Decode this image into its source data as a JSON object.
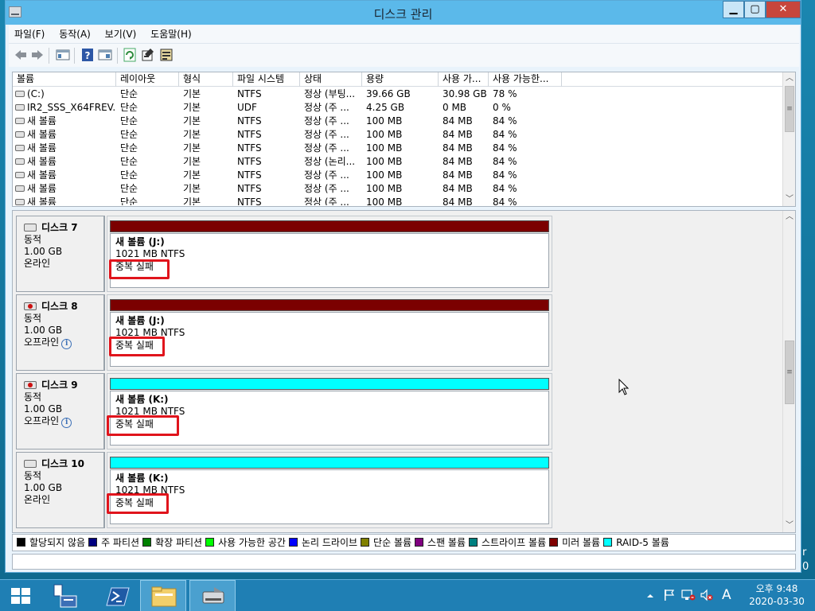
{
  "window": {
    "title": "디스크 관리",
    "min": "▁",
    "max": "▢",
    "close": "✕"
  },
  "menu": [
    "파일(F)",
    "동작(A)",
    "보기(V)",
    "도움말(H)"
  ],
  "volumes": {
    "columns": [
      "볼륨",
      "레이아웃",
      "형식",
      "파일 시스템",
      "상태",
      "용량",
      "사용 가...",
      "사용 가능한..."
    ],
    "rows": [
      [
        "(C:)",
        "단순",
        "기본",
        "NTFS",
        "정상 (부팅...",
        "39.66 GB",
        "30.98 GB",
        "78 %"
      ],
      [
        "IR2_SSS_X64FREV...",
        "단순",
        "기본",
        "UDF",
        "정상 (주 ...",
        "4.25 GB",
        "0 MB",
        "0 %"
      ],
      [
        "새 볼륨",
        "단순",
        "기본",
        "NTFS",
        "정상 (주 ...",
        "100 MB",
        "84 MB",
        "84 %"
      ],
      [
        "새 볼륨",
        "단순",
        "기본",
        "NTFS",
        "정상 (주 ...",
        "100 MB",
        "84 MB",
        "84 %"
      ],
      [
        "새 볼륨",
        "단순",
        "기본",
        "NTFS",
        "정상 (주 ...",
        "100 MB",
        "84 MB",
        "84 %"
      ],
      [
        "새 볼륨",
        "단순",
        "기본",
        "NTFS",
        "정상 (논리...",
        "100 MB",
        "84 MB",
        "84 %"
      ],
      [
        "새 볼륨",
        "단순",
        "기본",
        "NTFS",
        "정상 (주 ...",
        "100 MB",
        "84 MB",
        "84 %"
      ],
      [
        "새 볼륨",
        "단순",
        "기본",
        "NTFS",
        "정상 (주 ...",
        "100 MB",
        "84 MB",
        "84 %"
      ],
      [
        "새 볼륨",
        "단순",
        "기본",
        "NTFS",
        "정상 (주 ...",
        "100 MB",
        "84 MB",
        "84 %"
      ]
    ]
  },
  "disks": [
    {
      "name": "디스크 7",
      "type": "동적",
      "size": "1.00 GB",
      "status": "온라인",
      "info": false,
      "bar_color": "#7b0000",
      "vol_name": "새 볼륨  (J:)",
      "vol_size": "1021 MB NTFS",
      "vol_status": "중복 실패"
    },
    {
      "name": "디스크 8",
      "type": "동적",
      "size": "1.00 GB",
      "status": "오프라인",
      "info": true,
      "bar_color": "#7b0000",
      "vol_name": "새 볼륨  (J:)",
      "vol_size": "1021 MB NTFS",
      "vol_status": "중복 실패"
    },
    {
      "name": "디스크 9",
      "type": "동적",
      "size": "1.00 GB",
      "status": "오프라인",
      "info": true,
      "bar_color": "#00ffff",
      "vol_name": "새 볼륨  (K:)",
      "vol_size": "1021 MB NTFS",
      "vol_status": "중복 실패"
    },
    {
      "name": "디스크 10",
      "type": "동적",
      "size": "1.00 GB",
      "status": "온라인",
      "info": false,
      "bar_color": "#00ffff",
      "vol_name": "새 볼륨  (K:)",
      "vol_size": "1021 MB NTFS",
      "vol_status": "중복 실패"
    }
  ],
  "legend": [
    {
      "label": "할당되지 않음",
      "color": "#000000"
    },
    {
      "label": "주 파티션",
      "color": "#000080"
    },
    {
      "label": "확장 파티션",
      "color": "#008000"
    },
    {
      "label": "사용 가능한 공간",
      "color": "#00ff00"
    },
    {
      "label": "논리 드라이브",
      "color": "#0000ff"
    },
    {
      "label": "단순 볼륨",
      "color": "#808000"
    },
    {
      "label": "스팬 볼륨",
      "color": "#800080"
    },
    {
      "label": "스트라이프 볼륨",
      "color": "#008080"
    },
    {
      "label": "미러 볼륨",
      "color": "#800000"
    },
    {
      "label": "RAID-5 볼륨",
      "color": "#00ffff"
    }
  ],
  "desktop_peek": "r\n0",
  "tray_icons": [
    "up-arrow-icon",
    "flag-icon",
    "network-icon",
    "speaker-muted-icon",
    "ime-icon"
  ],
  "ime_label": "A",
  "clock": {
    "time": "오후 9:48",
    "date": "2020-03-30"
  }
}
